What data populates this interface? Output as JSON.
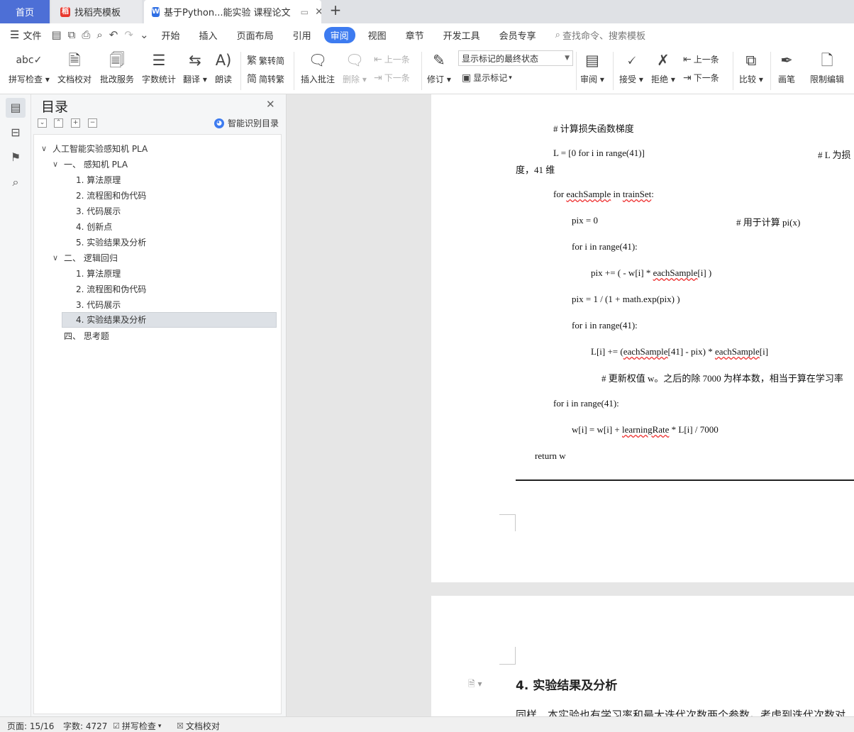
{
  "tabs": {
    "home": "首页",
    "template": "找稻壳模板",
    "doc": "基于Python...能实验 课程论文",
    "add": "+"
  },
  "menu": {
    "file": "文件",
    "items": [
      "开始",
      "插入",
      "页面布局",
      "引用",
      "审阅",
      "视图",
      "章节",
      "开发工具",
      "会员专享"
    ],
    "active": "审阅",
    "search_placeholder": "查找命令、搜索模板"
  },
  "ribbon": {
    "spellcheck": "拼写检查",
    "doc_check": "文档校对",
    "review_service": "批改服务",
    "word_count": "字数统计",
    "translate": "翻译",
    "read_aloud": "朗读",
    "trad_to_simp": "繁转简",
    "simp_to_trad": "简转繁",
    "insert_comment": "插入批注",
    "delete": "删除",
    "prev_comment": "上一条",
    "next_comment": "下一条",
    "track_changes": "修订",
    "markup_select": "显示标记的最终状态",
    "show_markup": "显示标记",
    "review": "审阅",
    "accept": "接受",
    "reject": "拒绝",
    "prev_change": "上一条",
    "next_change": "下一条",
    "compare": "比较",
    "pen": "画笔",
    "restrict_edit": "限制编辑"
  },
  "nav": {
    "title": "目录",
    "smart_toc": "智能识别目录",
    "items": [
      {
        "label": "人工智能实验感知机 PLA",
        "collapse": "∨"
      },
      {
        "label": "一、  感知机 PLA",
        "collapse": "∨"
      },
      {
        "label": "1. 算法原理"
      },
      {
        "label": "2. 流程图和伪代码"
      },
      {
        "label": "3. 代码展示"
      },
      {
        "label": "4. 创新点"
      },
      {
        "label": "5. 实验结果及分析"
      },
      {
        "label": "二、  逻辑回归",
        "collapse": "∨"
      },
      {
        "label": "1. 算法原理"
      },
      {
        "label": "2. 流程图和伪代码"
      },
      {
        "label": "3. 代码展示"
      },
      {
        "label": "4. 实验结果及分析"
      },
      {
        "label": "四、  思考题"
      }
    ]
  },
  "doc": {
    "code_lines": [
      {
        "pre": "#  计算损失函数梯度"
      },
      {
        "pre": "L = [0 for i in range(41)]"
      },
      {
        "pre": "# L 为损"
      },
      {
        "pre": "度，41 维"
      },
      {
        "pre": "for ",
        "sq": "eachSample",
        "post": " in ",
        "sq2": "trainSet",
        "post2": ":"
      },
      {
        "pre": "pix = 0"
      },
      {
        "pre": "#  用于计算 pi(x)"
      },
      {
        "pre": "for i in range(41):"
      },
      {
        "pre": "pix += ( - w[i]  * ",
        "sq": "eachSample",
        "post": "[i] )"
      },
      {
        "pre": "pix = 1 / (1 + math.exp(pix) )"
      },
      {
        "pre": "for i in range(41):"
      },
      {
        "pre": "L[i] += (",
        "sq": "eachSample",
        "post": "[41] - pix) * ",
        "sq2": "eachSample",
        "post2": "[i]"
      },
      {
        "pre": "#  更新权值 w。之后的除 7000 为样本数，相当于算在学习率"
      },
      {
        "pre": "for i in range(41):"
      },
      {
        "pre": "w[i]  = w[i]  + ",
        "sq": "learningRate",
        "post": " * L[i] / 7000"
      },
      {
        "pre": "return w"
      }
    ],
    "heading": "4.  实验结果及分析",
    "body": "同样，本实验也有学习率和最大迭代次数两个参数。考虑到迭代次数对"
  },
  "status": {
    "page": "页面: 15/16",
    "words": "字数: 4727",
    "spellcheck": "拼写检查",
    "doc_check": "文档校对"
  }
}
